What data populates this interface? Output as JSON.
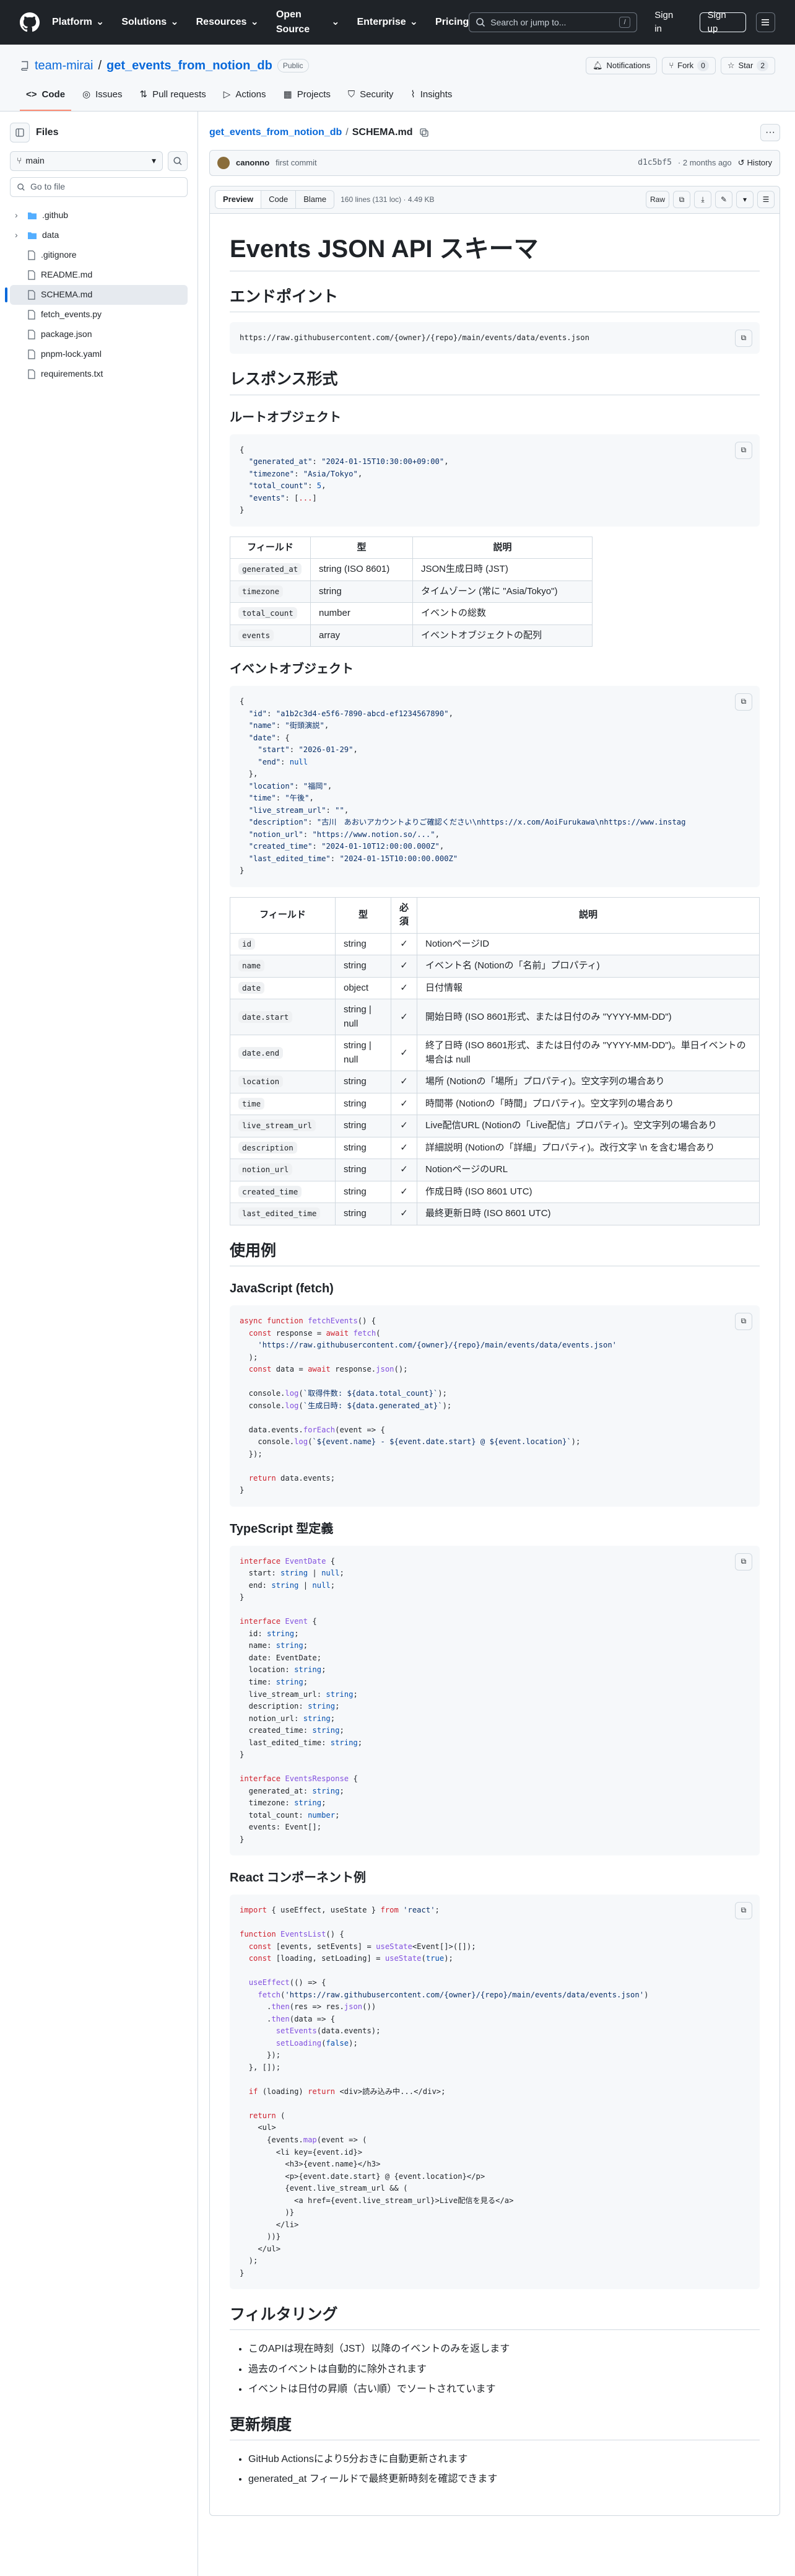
{
  "header": {
    "nav": [
      "Platform",
      "Solutions",
      "Resources",
      "Open Source",
      "Enterprise",
      "Pricing"
    ],
    "search_placeholder": "Search or jump to...",
    "search_kbd": "/",
    "sign_in": "Sign in",
    "sign_up": "Sign up"
  },
  "repo": {
    "owner": "team-mirai",
    "name": "get_events_from_notion_db",
    "visibility": "Public",
    "notifications": "Notifications",
    "fork": "Fork",
    "fork_count": "0",
    "star": "Star",
    "star_count": "2",
    "tabs": [
      "Code",
      "Issues",
      "Pull requests",
      "Actions",
      "Projects",
      "Security",
      "Insights"
    ]
  },
  "sidebar": {
    "title": "Files",
    "branch": "main",
    "goto_placeholder": "Go to file",
    "items": [
      {
        "name": ".github",
        "type": "folder"
      },
      {
        "name": "data",
        "type": "folder"
      },
      {
        "name": ".gitignore",
        "type": "file"
      },
      {
        "name": "README.md",
        "type": "file"
      },
      {
        "name": "SCHEMA.md",
        "type": "file",
        "selected": true
      },
      {
        "name": "fetch_events.py",
        "type": "file"
      },
      {
        "name": "package.json",
        "type": "file"
      },
      {
        "name": "pnpm-lock.yaml",
        "type": "file"
      },
      {
        "name": "requirements.txt",
        "type": "file"
      }
    ]
  },
  "file": {
    "repo_link": "get_events_from_notion_db",
    "sep": "/",
    "name": "SCHEMA.md",
    "commit_user": "canonno",
    "commit_msg": "first commit",
    "commit_hash": "d1c5bf5",
    "commit_time": "· 2 months ago",
    "history": "History",
    "view_tabs": [
      "Preview",
      "Code",
      "Blame"
    ],
    "meta": "160 lines (131 loc) · 4.49 KB",
    "raw": "Raw"
  },
  "doc": {
    "h1": "Events JSON API スキーマ",
    "endpoint_h": "エンドポイント",
    "endpoint_url": "https://raw.githubusercontent.com/{owner}/{repo}/main/events/data/events.json",
    "response_h": "レスポンス形式",
    "root_h": "ルートオブジェクト",
    "root_table": {
      "headers": [
        "フィールド",
        "型",
        "説明"
      ],
      "rows": [
        [
          "generated_at",
          "string (ISO 8601)",
          "JSON生成日時 (JST)"
        ],
        [
          "timezone",
          "string",
          "タイムゾーン (常に \"Asia/Tokyo\")"
        ],
        [
          "total_count",
          "number",
          "イベントの総数"
        ],
        [
          "events",
          "array",
          "イベントオブジェクトの配列"
        ]
      ]
    },
    "event_h": "イベントオブジェクト",
    "event_table": {
      "headers": [
        "フィールド",
        "型",
        "必須",
        "説明"
      ],
      "rows": [
        [
          "id",
          "string",
          "✓",
          "NotionページID"
        ],
        [
          "name",
          "string",
          "✓",
          "イベント名 (Notionの「名前」プロパティ)"
        ],
        [
          "date",
          "object",
          "✓",
          "日付情報"
        ],
        [
          "date.start",
          "string | null",
          "✓",
          "開始日時 (ISO 8601形式、または日付のみ \"YYYY-MM-DD\")"
        ],
        [
          "date.end",
          "string | null",
          "✓",
          "終了日時 (ISO 8601形式、または日付のみ \"YYYY-MM-DD\")。単日イベントの場合は null"
        ],
        [
          "location",
          "string",
          "✓",
          "場所 (Notionの「場所」プロパティ)。空文字列の場合あり"
        ],
        [
          "time",
          "string",
          "✓",
          "時間帯 (Notionの「時間」プロパティ)。空文字列の場合あり"
        ],
        [
          "live_stream_url",
          "string",
          "✓",
          "Live配信URL (Notionの「Live配信」プロパティ)。空文字列の場合あり"
        ],
        [
          "description",
          "string",
          "✓",
          "詳細説明 (Notionの「詳細」プロパティ)。改行文字 \\n を含む場合あり"
        ],
        [
          "notion_url",
          "string",
          "✓",
          "NotionページのURL"
        ],
        [
          "created_time",
          "string",
          "✓",
          "作成日時 (ISO 8601 UTC)"
        ],
        [
          "last_edited_time",
          "string",
          "✓",
          "最終更新日時 (ISO 8601 UTC)"
        ]
      ]
    },
    "usage_h": "使用例",
    "js_h": "JavaScript (fetch)",
    "ts_h": "TypeScript 型定義",
    "react_h": "React コンポーネント例",
    "filter_h": "フィルタリング",
    "filter_items": [
      "このAPIは現在時刻（JST）以降のイベントのみを返します",
      "過去のイベントは自動的に除外されます",
      "イベントは日付の昇順（古い順）でソートされています"
    ],
    "update_h": "更新頻度",
    "update_items": [
      "GitHub Actionsにより5分おきに自動更新されます",
      "generated_at フィールドで最終更新時刻を確認できます"
    ]
  },
  "colors": {
    "header_bg": "#1f2328",
    "link": "#0969da",
    "tab_underline": "#fd8c73",
    "code_bg": "#f6f8fa",
    "keyword": "#cf222e",
    "string": "#0a3069"
  }
}
